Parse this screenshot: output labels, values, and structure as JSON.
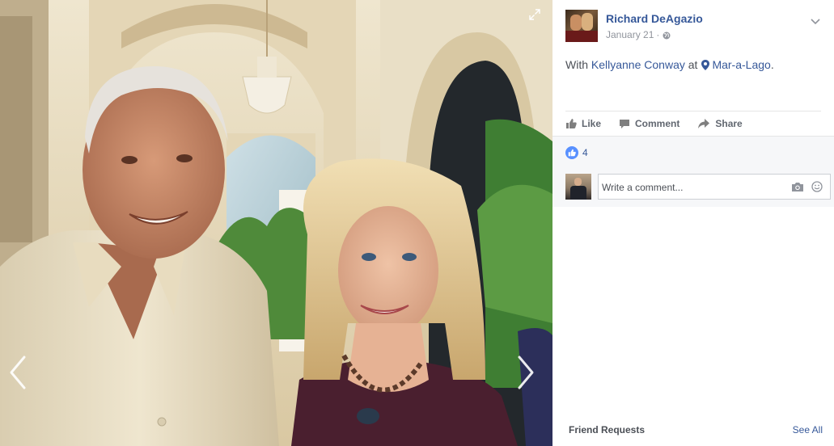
{
  "post": {
    "author": "Richard DeAgazio",
    "date": "January 21",
    "separator": "·",
    "privacy_icon": "globe-icon",
    "caption": {
      "with_prefix": "With",
      "tagged_person": "Kellyanne Conway",
      "at_word": "at",
      "location": "Mar-a-Lago",
      "end": "."
    }
  },
  "actions": {
    "like": "Like",
    "comment": "Comment",
    "share": "Share"
  },
  "feedback": {
    "like_count": "4",
    "comment_placeholder": "Write a comment..."
  },
  "sidebar": {
    "friend_requests_title": "Friend Requests",
    "see_all": "See All"
  },
  "colors": {
    "link": "#365899",
    "like_badge": "#5890ff",
    "muted": "#90949c",
    "feedback_bg": "#f6f7f9"
  }
}
